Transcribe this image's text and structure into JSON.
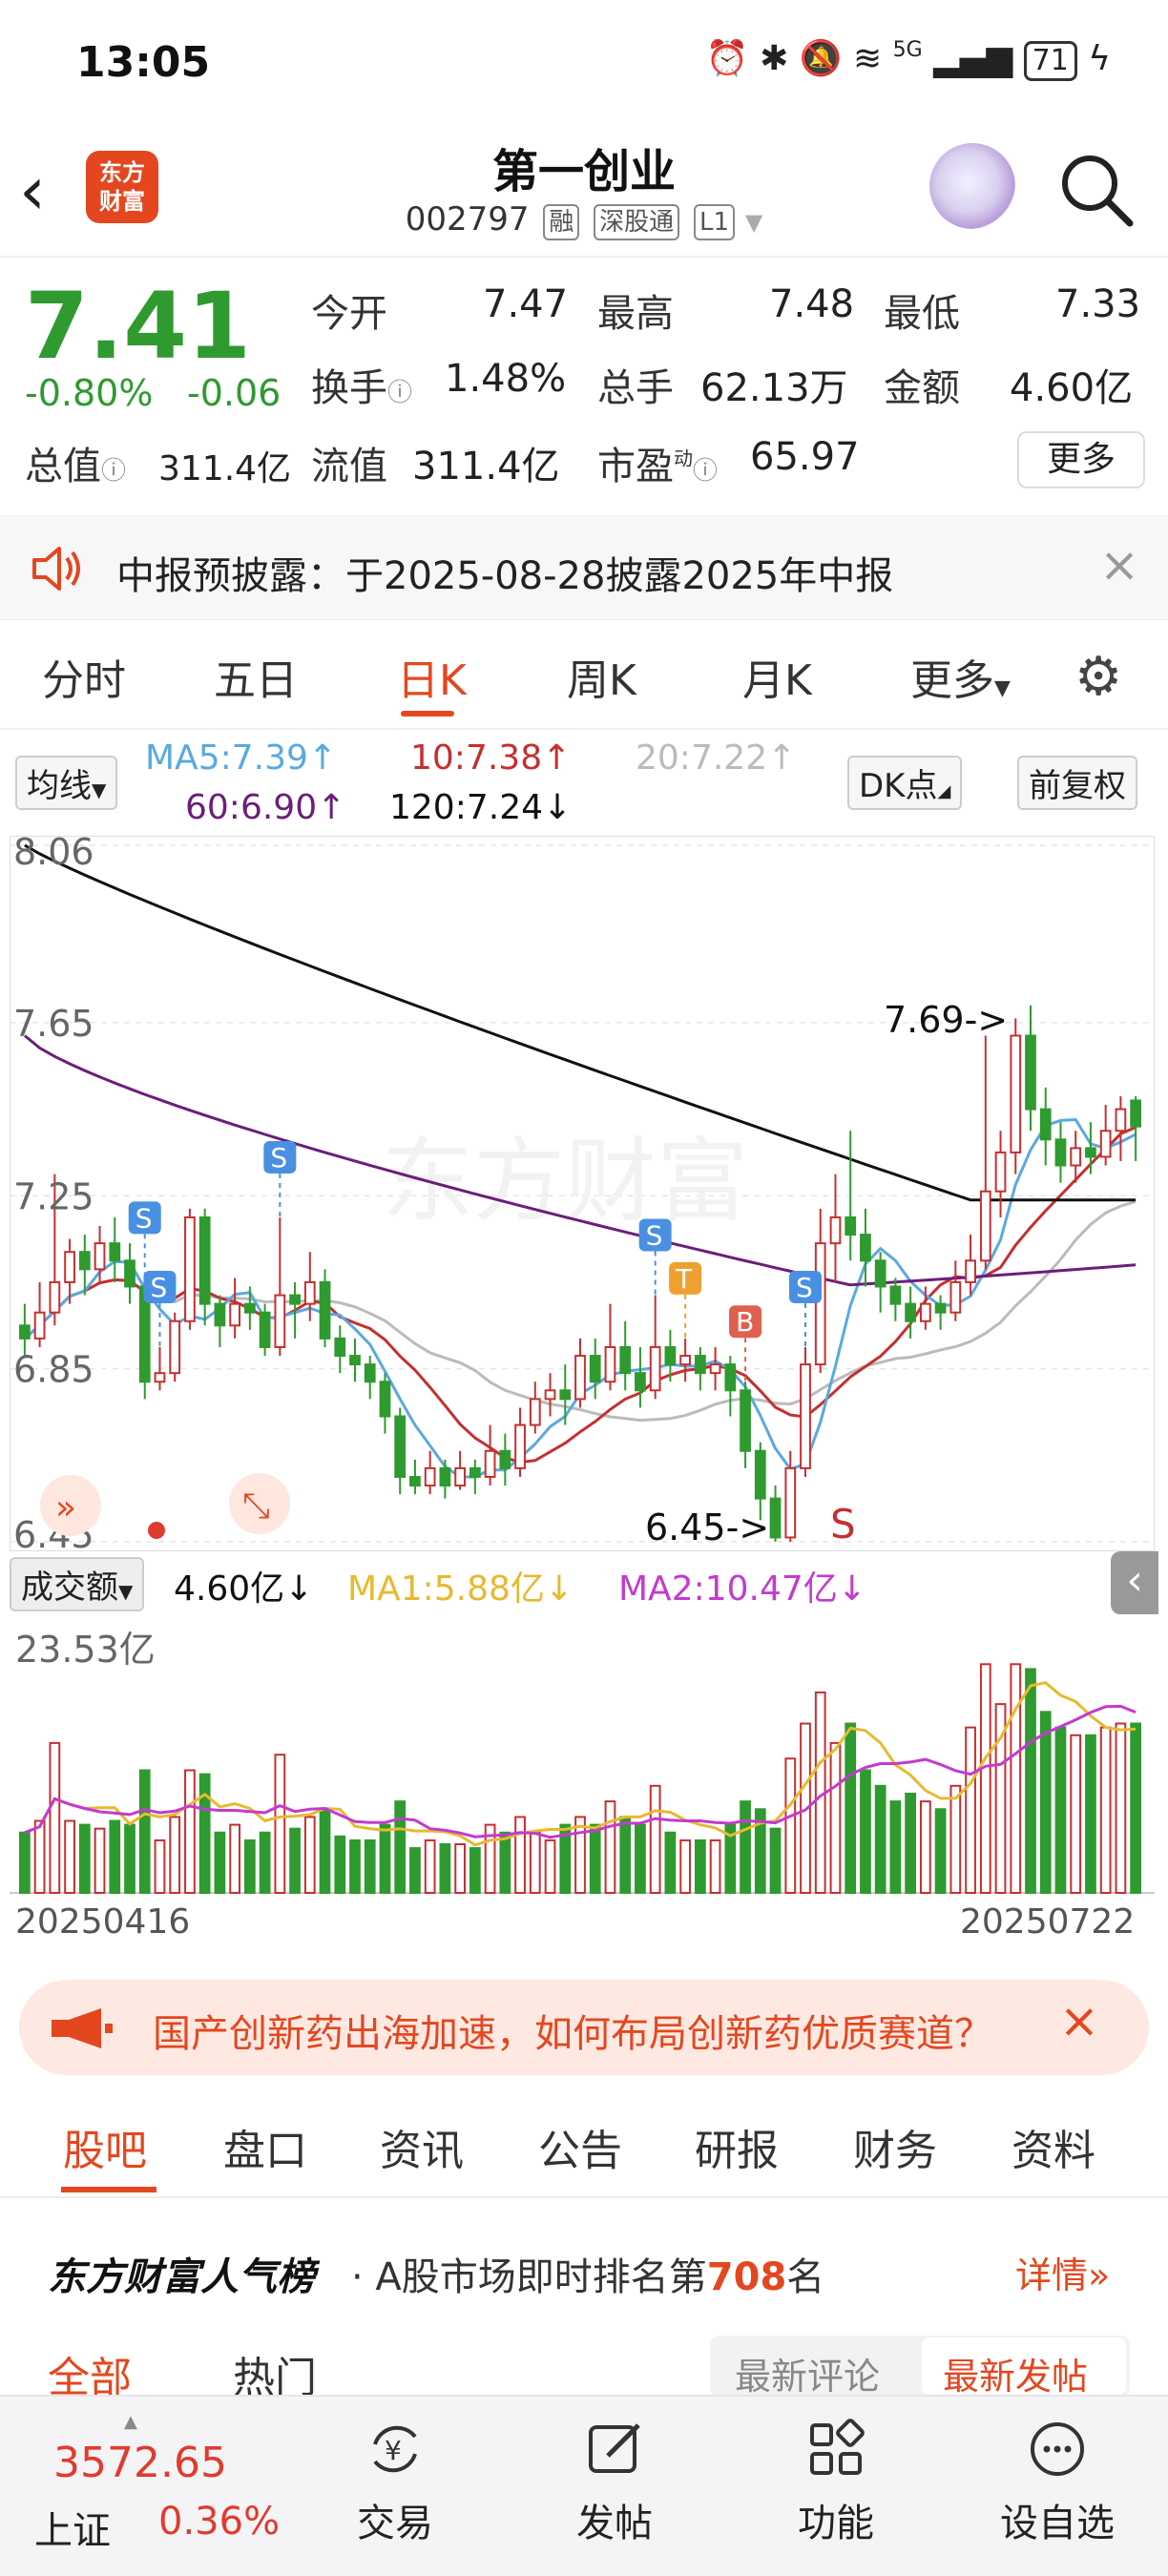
{
  "status_bar": {
    "time": "13:05",
    "network": "5G",
    "battery": "71"
  },
  "header": {
    "stock_name": "第一创业",
    "stock_code": "002797",
    "tags": [
      "融",
      "深股通",
      "L1"
    ],
    "logo_text_1": "东方",
    "logo_text_2": "财富"
  },
  "quote": {
    "price": "7.41",
    "change_pct": "-0.80%",
    "change_abs": "-0.06",
    "open_label": "今开",
    "open": "7.47",
    "high_label": "最高",
    "high": "7.48",
    "low_label": "最低",
    "low": "7.33",
    "turnover_label": "换手",
    "turnover": "1.48%",
    "volume_label": "总手",
    "volume": "62.13万",
    "amount_label": "金额",
    "amount": "4.60亿",
    "mcap_label": "总值",
    "mcap": "311.4亿",
    "float_label": "流值",
    "float_cap": "311.4亿",
    "pe_label": "市盈",
    "pe_sup": "动",
    "pe": "65.97",
    "more_label": "更多"
  },
  "notice": {
    "text": "中报预披露：于2025-08-28披露2025年中报"
  },
  "chart_tabs": [
    {
      "label": "分时"
    },
    {
      "label": "五日"
    },
    {
      "label": "日K"
    },
    {
      "label": "周K"
    },
    {
      "label": "月K"
    },
    {
      "label": "更多"
    }
  ],
  "ma_row": {
    "indicator": "均线",
    "ma5": "MA5:7.39↑",
    "ma10": "10:7.38↑",
    "ma20": "20:7.22↑",
    "ma60": "60:6.90↑",
    "ma120": "120:7.24↓",
    "dk_label": "DK点",
    "adjust_label": "前复权",
    "colors": {
      "ma5": "#5aa9e0",
      "ma10": "#c62f2f",
      "ma20": "#bbbbbb",
      "ma60": "#6b1e7a",
      "ma120": "#111111"
    }
  },
  "chart_data": {
    "type": "candlestick",
    "price_axis": {
      "ticks": [
        "8.06",
        "7.65",
        "7.25",
        "6.85",
        "6.45"
      ],
      "ylim": [
        6.45,
        8.06
      ]
    },
    "annotations": {
      "high": "7.69->",
      "low": "6.45->",
      "sell_mark": "S"
    },
    "signals": [
      {
        "label": "S",
        "index": 8
      },
      {
        "label": "S",
        "index": 9
      },
      {
        "label": "S",
        "index": 17
      },
      {
        "label": "S",
        "index": 42
      },
      {
        "label": "T",
        "index": 44
      },
      {
        "label": "B",
        "index": 48
      },
      {
        "label": "S",
        "index": 52
      }
    ],
    "candles": [
      [
        6.95,
        6.92,
        7.0,
        6.88
      ],
      [
        6.92,
        6.98,
        7.05,
        6.9
      ],
      [
        6.98,
        7.05,
        7.3,
        6.95
      ],
      [
        7.05,
        7.12,
        7.15,
        7.0
      ],
      [
        7.12,
        7.08,
        7.16,
        7.02
      ],
      [
        7.08,
        7.14,
        7.18,
        7.05
      ],
      [
        7.14,
        7.1,
        7.2,
        7.05
      ],
      [
        7.1,
        7.04,
        7.14,
        7.0
      ],
      [
        7.04,
        6.82,
        7.06,
        6.78
      ],
      [
        6.82,
        6.84,
        6.9,
        6.8
      ],
      [
        6.84,
        6.96,
        6.98,
        6.82
      ],
      [
        6.96,
        7.2,
        7.22,
        6.94
      ],
      [
        7.2,
        7.0,
        7.22,
        6.95
      ],
      [
        7.0,
        6.95,
        7.02,
        6.9
      ],
      [
        6.95,
        7.0,
        7.06,
        6.92
      ],
      [
        7.0,
        6.98,
        7.04,
        6.94
      ],
      [
        6.98,
        6.9,
        7.0,
        6.88
      ],
      [
        6.9,
        7.02,
        7.2,
        6.88
      ],
      [
        7.02,
        7.0,
        7.05,
        6.92
      ],
      [
        7.0,
        7.05,
        7.12,
        6.96
      ],
      [
        7.05,
        6.92,
        7.08,
        6.9
      ],
      [
        6.92,
        6.88,
        6.95,
        6.84
      ],
      [
        6.88,
        6.86,
        6.92,
        6.82
      ],
      [
        6.86,
        6.82,
        6.88,
        6.78
      ],
      [
        6.82,
        6.74,
        6.84,
        6.7
      ],
      [
        6.74,
        6.6,
        6.76,
        6.56
      ],
      [
        6.6,
        6.58,
        6.64,
        6.56
      ],
      [
        6.58,
        6.62,
        6.66,
        6.56
      ],
      [
        6.62,
        6.58,
        6.64,
        6.55
      ],
      [
        6.58,
        6.62,
        6.66,
        6.57
      ],
      [
        6.62,
        6.6,
        6.64,
        6.56
      ],
      [
        6.6,
        6.66,
        6.72,
        6.58
      ],
      [
        6.66,
        6.62,
        6.7,
        6.58
      ],
      [
        6.62,
        6.72,
        6.76,
        6.6
      ],
      [
        6.72,
        6.78,
        6.82,
        6.7
      ],
      [
        6.78,
        6.8,
        6.84,
        6.74
      ],
      [
        6.8,
        6.78,
        6.86,
        6.72
      ],
      [
        6.78,
        6.88,
        6.92,
        6.76
      ],
      [
        6.88,
        6.82,
        6.92,
        6.78
      ],
      [
        6.82,
        6.9,
        7.0,
        6.8
      ],
      [
        6.9,
        6.84,
        6.96,
        6.8
      ],
      [
        6.84,
        6.8,
        6.9,
        6.76
      ],
      [
        6.8,
        6.9,
        7.02,
        6.78
      ],
      [
        6.9,
        6.86,
        6.94,
        6.82
      ],
      [
        6.86,
        6.88,
        6.92,
        6.82
      ],
      [
        6.88,
        6.84,
        6.9,
        6.8
      ],
      [
        6.84,
        6.86,
        6.9,
        6.8
      ],
      [
        6.86,
        6.8,
        6.88,
        6.74
      ],
      [
        6.8,
        6.66,
        6.82,
        6.62
      ],
      [
        6.66,
        6.55,
        6.68,
        6.5
      ],
      [
        6.55,
        6.46,
        6.58,
        6.45
      ],
      [
        6.46,
        6.62,
        6.66,
        6.45
      ],
      [
        6.62,
        6.86,
        6.9,
        6.6
      ],
      [
        6.86,
        7.14,
        7.22,
        6.84
      ],
      [
        7.14,
        7.2,
        7.3,
        7.05
      ],
      [
        7.2,
        7.16,
        7.4,
        7.1
      ],
      [
        7.16,
        7.1,
        7.22,
        7.04
      ],
      [
        7.1,
        7.04,
        7.12,
        6.98
      ],
      [
        7.04,
        7.0,
        7.06,
        6.96
      ],
      [
        7.0,
        6.96,
        7.04,
        6.92
      ],
      [
        6.96,
        7.0,
        7.04,
        6.94
      ],
      [
        7.0,
        6.98,
        7.02,
        6.94
      ],
      [
        6.98,
        7.05,
        7.1,
        6.96
      ],
      [
        7.05,
        7.1,
        7.16,
        7.02
      ],
      [
        7.1,
        7.26,
        7.62,
        7.08
      ],
      [
        7.26,
        7.35,
        7.4,
        7.2
      ],
      [
        7.35,
        7.62,
        7.66,
        7.3
      ],
      [
        7.62,
        7.45,
        7.69,
        7.4
      ],
      [
        7.45,
        7.38,
        7.5,
        7.32
      ],
      [
        7.38,
        7.32,
        7.42,
        7.28
      ],
      [
        7.32,
        7.36,
        7.4,
        7.28
      ],
      [
        7.36,
        7.34,
        7.42,
        7.3
      ],
      [
        7.34,
        7.4,
        7.46,
        7.32
      ],
      [
        7.4,
        7.45,
        7.48,
        7.33
      ],
      [
        7.47,
        7.41,
        7.48,
        7.33
      ]
    ],
    "volume_axis": {
      "max_label": "23.53亿"
    },
    "volume_legend": {
      "name": "成交额",
      "value": "4.60亿↓",
      "ma1": "MA1:5.88亿↓",
      "ma2": "MA2:10.47亿↓"
    },
    "date_start": "20250416",
    "date_end": "20250722"
  },
  "promo": {
    "text": "国产创新药出海加速，如何布局创新药优质赛道？"
  },
  "section_tabs": [
    {
      "label": "股吧"
    },
    {
      "label": "盘口"
    },
    {
      "label": "资讯"
    },
    {
      "label": "公告"
    },
    {
      "label": "研报"
    },
    {
      "label": "财务"
    },
    {
      "label": "资料"
    }
  ],
  "ranking": {
    "title": "东方财富人气榜",
    "text_prefix": "· A股市场即时排名第",
    "rank": "708",
    "text_suffix": "名",
    "detail_label": "详情"
  },
  "feed_tabs": {
    "all": "全部",
    "hot": "热门",
    "latest_comment": "最新评论",
    "latest_post": "最新发帖"
  },
  "bottom_bar": {
    "index_value": "3572.65",
    "index_name": "上证",
    "index_change": "0.36%",
    "trade_label": "交易",
    "post_label": "发帖",
    "function_label": "功能",
    "watchlist_label": "设自选"
  }
}
